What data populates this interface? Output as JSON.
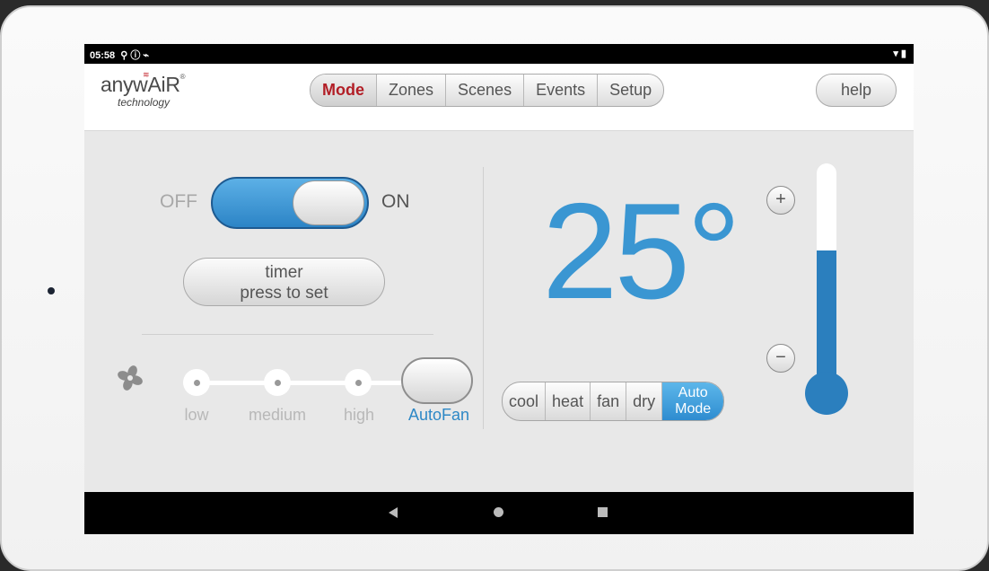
{
  "status_bar": {
    "time": "05:58",
    "icons_left": "⚲ ⓘ ⌁",
    "icons_right": "▾ ▮"
  },
  "logo": {
    "word": "anywAiR",
    "sup": "®",
    "sub": "technology"
  },
  "nav": {
    "tabs": [
      {
        "label": "Mode"
      },
      {
        "label": "Zones"
      },
      {
        "label": "Scenes"
      },
      {
        "label": "Events"
      },
      {
        "label": "Setup"
      }
    ],
    "active_tab": "Mode",
    "help_label": "help"
  },
  "power": {
    "off_label": "OFF",
    "on_label": "ON",
    "state": "on"
  },
  "timer": {
    "line1": "timer",
    "line2": "press to set"
  },
  "fan": {
    "levels": [
      {
        "label": "low"
      },
      {
        "label": "medium"
      },
      {
        "label": "high"
      },
      {
        "label": "AutoFan"
      }
    ],
    "selected": "AutoFan"
  },
  "temperature": {
    "value": "25°",
    "plus": "+",
    "minus": "−",
    "level_fraction": 0.62
  },
  "modes": {
    "items": [
      {
        "label": "cool"
      },
      {
        "label": "heat"
      },
      {
        "label": "fan"
      },
      {
        "label": "dry"
      },
      {
        "label_line1": "Auto",
        "label_line2": "Mode"
      }
    ],
    "selected": "Auto Mode"
  },
  "colors": {
    "accent_blue": "#3a96d2",
    "brand_red": "#b21e26",
    "fill_blue": "#2b7fbe"
  }
}
